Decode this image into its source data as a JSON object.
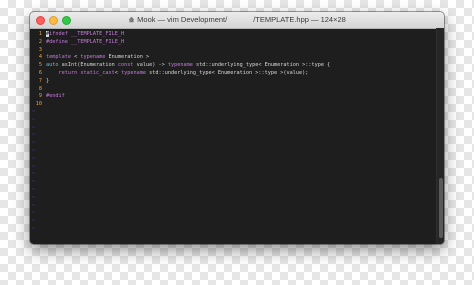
{
  "window": {
    "title_left": "Mook — vim Development/",
    "title_right": "/TEMPLATE.hpp — 124×28"
  },
  "editor": {
    "lines": [
      {
        "n": "1",
        "parts": [
          {
            "t": "#",
            "c": "cursor"
          },
          {
            "t": "ifndef __TEMPLATE_FILE_H",
            "c": "pre"
          }
        ]
      },
      {
        "n": "2",
        "parts": [
          {
            "t": "#define __TEMPLATE_FILE_H",
            "c": "pre"
          }
        ]
      },
      {
        "n": "3",
        "parts": []
      },
      {
        "n": "4",
        "parts": [
          {
            "t": "template",
            "c": "kw"
          },
          {
            "t": " < ",
            "c": ""
          },
          {
            "t": "typename",
            "c": "kw"
          },
          {
            "t": " Enumeration >",
            "c": ""
          }
        ]
      },
      {
        "n": "5",
        "parts": [
          {
            "t": "auto",
            "c": "ty"
          },
          {
            "t": " asInt(Enumeration ",
            "c": ""
          },
          {
            "t": "const",
            "c": "kw"
          },
          {
            "t": " value) -> ",
            "c": ""
          },
          {
            "t": "typename",
            "c": "kw"
          },
          {
            "t": " std::underlying_type< Enumeration >::type {",
            "c": ""
          }
        ]
      },
      {
        "n": "6",
        "parts": [
          {
            "t": "    ",
            "c": ""
          },
          {
            "t": "return",
            "c": "kw"
          },
          {
            "t": " ",
            "c": ""
          },
          {
            "t": "static_cast",
            "c": "kw"
          },
          {
            "t": "< ",
            "c": ""
          },
          {
            "t": "typename",
            "c": "kw"
          },
          {
            "t": " std::underlying_type< Enumeration >::type >(value);",
            "c": ""
          }
        ]
      },
      {
        "n": "7",
        "parts": [
          {
            "t": "}",
            "c": ""
          }
        ]
      },
      {
        "n": "8",
        "parts": []
      },
      {
        "n": "9",
        "parts": [
          {
            "t": "#endif",
            "c": "pre"
          }
        ]
      },
      {
        "n": "10",
        "parts": []
      }
    ],
    "tilde": "~",
    "tilde_count": 16
  },
  "colors": {
    "background": "#1e1e1e",
    "line_number": "#e8a33d",
    "preprocessor": "#c678dd",
    "keyword": "#c678dd",
    "type": "#56c7d9",
    "text": "#d8d8d8",
    "tilde": "#3c4a8c"
  }
}
